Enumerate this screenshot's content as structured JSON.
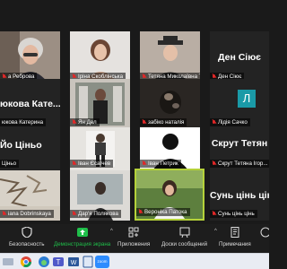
{
  "participants": [
    {
      "name": "а Реброва",
      "muted": true
    },
    {
      "name": "Іріна Скоблінська",
      "muted": true
    },
    {
      "name": "Тетяна Миколаївна Тр...",
      "muted": true
    },
    {
      "name": "Ден Сіює",
      "big_name": "Ден Сіює",
      "muted": true
    },
    {
      "name": "юкова Катерина",
      "big_name": "юкова Кате...",
      "muted": false
    },
    {
      "name": "Ян Дел",
      "muted": true
    },
    {
      "name": "забіко наталія",
      "muted": true
    },
    {
      "name": "Лідія Сачко",
      "initial": "Л",
      "muted": true
    },
    {
      "name": "Ціньо",
      "big_name": "Йо Ціньо",
      "muted": false
    },
    {
      "name": "Іван Єсаїчев",
      "muted": true
    },
    {
      "name": "Іван Петрик",
      "muted": true
    },
    {
      "name": "Скрут Тетяна Ігор...",
      "big_name": "Скрут Тетян",
      "muted": true
    },
    {
      "name": "iana Dobrinskaya",
      "muted": true
    },
    {
      "name": "Дар'я Полякова",
      "muted": true
    },
    {
      "name": "Вероніка Патока",
      "muted": true,
      "active": true
    },
    {
      "name": "Сунь цінь цінь",
      "big_name": "Сунь цінь цін",
      "muted": true
    }
  ],
  "toolbar": {
    "security": "Безопасность",
    "share_screen": "Демонстрация экрана",
    "apps": "Приложения",
    "whiteboards": "Доски сообщений",
    "notes": "Примечания",
    "share_screen_color": "#1fbf4a"
  },
  "taskbar": {
    "apps": [
      "chrome-icon",
      "teams-icon",
      "word-icon",
      "zoom-icon"
    ],
    "zoom_label": "zoom"
  }
}
